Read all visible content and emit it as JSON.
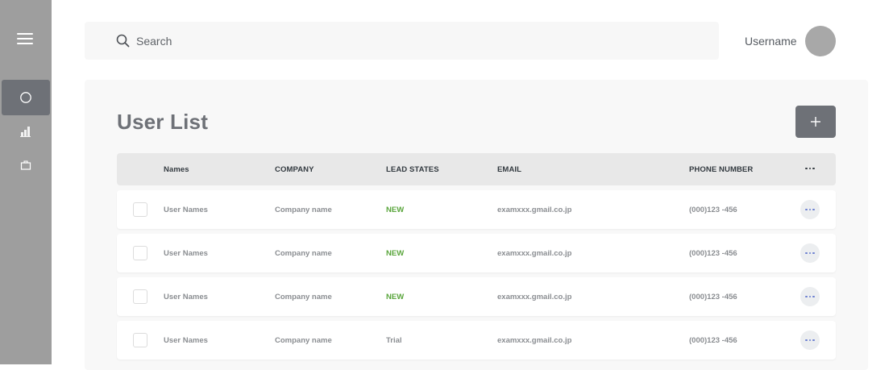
{
  "search": {
    "placeholder": "Search"
  },
  "user": {
    "username": "Username"
  },
  "page": {
    "title": "User List",
    "add_button_label": "+"
  },
  "table": {
    "headers": [
      "Names",
      "COMPANY",
      "LEAD STATES",
      "EMAIL",
      "PHONE NUMBER"
    ],
    "rows": [
      {
        "name": "User Names",
        "company": "Company name",
        "lead_state": "NEW",
        "email": "examxxx.gmail.co.jp",
        "phone": "(000)123 -456"
      },
      {
        "name": "User Names",
        "company": "Company name",
        "lead_state": "NEW",
        "email": "examxxx.gmail.co.jp",
        "phone": "(000)123 -456"
      },
      {
        "name": "User Names",
        "company": "Company name",
        "lead_state": "NEW",
        "email": "examxxx.gmail.co.jp",
        "phone": "(000)123 -456"
      },
      {
        "name": "User Names",
        "company": "Company name",
        "lead_state": "Trial",
        "email": "examxxx.gmail.co.jp",
        "phone": "(000)123 -456"
      }
    ]
  },
  "sidebar": {
    "items": [
      {
        "icon": "circle-icon",
        "active": true
      },
      {
        "icon": "bar-chart-icon",
        "active": false
      },
      {
        "icon": "briefcase-icon",
        "active": false
      }
    ]
  },
  "colors": {
    "sidebar": "#9e9e9e",
    "accent": "#6e7177",
    "lead_new": "#59a53b",
    "more_dots": "#6b7fd0"
  }
}
